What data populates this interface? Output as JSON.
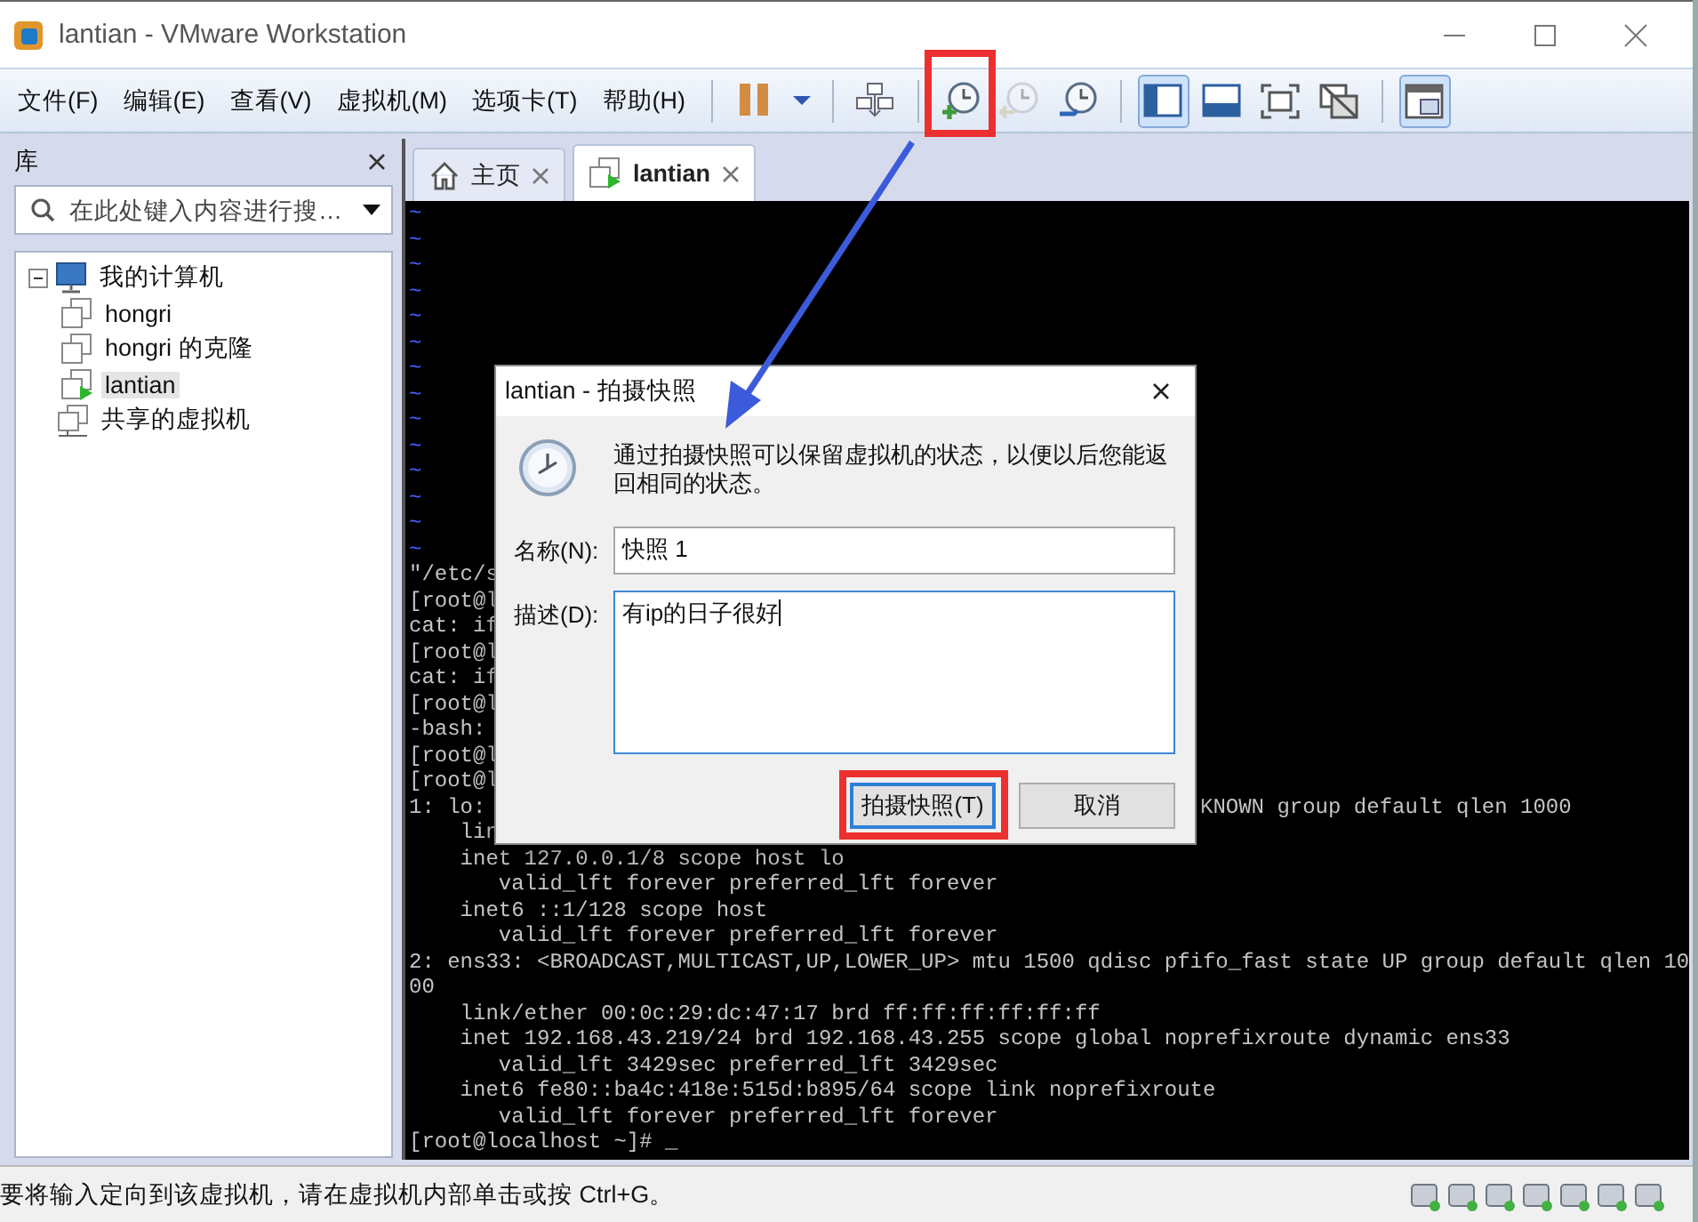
{
  "window": {
    "title": "lantian - VMware Workstation"
  },
  "menu": [
    "文件(F)",
    "编辑(E)",
    "查看(V)",
    "虚拟机(M)",
    "选项卡(T)",
    "帮助(H)"
  ],
  "toolbar": {
    "groups": [
      [
        {
          "kind": "pause",
          "selected": false,
          "disabled": false,
          "highlighted": false
        },
        {
          "kind": "caret",
          "selected": false,
          "disabled": false,
          "highlighted": false
        }
      ],
      [
        {
          "kind": "send-keys",
          "selected": false,
          "disabled": false,
          "highlighted": false
        }
      ],
      [
        {
          "kind": "snapshot-take",
          "selected": false,
          "disabled": false,
          "highlighted": true
        },
        {
          "kind": "snapshot-revert",
          "selected": false,
          "disabled": true,
          "highlighted": false
        },
        {
          "kind": "snapshot-manager",
          "selected": false,
          "disabled": false,
          "highlighted": false
        }
      ],
      [
        {
          "kind": "console-view",
          "selected": true,
          "disabled": false,
          "highlighted": false
        },
        {
          "kind": "thumbnail-bar",
          "selected": false,
          "disabled": false,
          "highlighted": false
        },
        {
          "kind": "full-screen",
          "selected": false,
          "disabled": false,
          "highlighted": false
        },
        {
          "kind": "unity",
          "selected": false,
          "disabled": false,
          "highlighted": false
        }
      ],
      [
        {
          "kind": "library-view",
          "selected": true,
          "disabled": false,
          "highlighted": false
        }
      ]
    ]
  },
  "library": {
    "title": "库",
    "search": {
      "placeholder": "在此处键入内容进行搜…"
    },
    "tree": [
      {
        "label": "我的计算机",
        "kind": "computer",
        "expanded": true,
        "selected": false,
        "children": [
          {
            "label": "hongri",
            "kind": "vm",
            "selected": false
          },
          {
            "label": "hongri 的克隆",
            "kind": "vm",
            "selected": false
          },
          {
            "label": "lantian",
            "kind": "vm-running",
            "selected": true
          }
        ]
      },
      {
        "label": "共享的虚拟机",
        "kind": "shared",
        "selected": false
      }
    ]
  },
  "tabs": [
    {
      "label": "主页",
      "kind": "home",
      "selected": false
    },
    {
      "label": "lantian",
      "kind": "vm",
      "selected": true
    }
  ],
  "terminal": {
    "lines": [
      {
        "text": "~",
        "kind": "tilde"
      },
      {
        "text": "~",
        "kind": "tilde"
      },
      {
        "text": "~",
        "kind": "tilde"
      },
      {
        "text": "~",
        "kind": "tilde"
      },
      {
        "text": "~",
        "kind": "tilde"
      },
      {
        "text": "~",
        "kind": "tilde"
      },
      {
        "text": "~",
        "kind": "tilde"
      },
      {
        "text": "~",
        "kind": "tilde"
      },
      {
        "text": "~",
        "kind": "tilde"
      },
      {
        "text": "~",
        "kind": "tilde"
      },
      {
        "text": "~",
        "kind": "tilde"
      },
      {
        "text": "~",
        "kind": "tilde"
      },
      {
        "text": "~",
        "kind": "tilde"
      },
      {
        "text": "~",
        "kind": "tilde"
      },
      {
        "text": "\"/etc/s",
        "kind": "output"
      },
      {
        "text": "[root@l",
        "kind": "output"
      },
      {
        "text": "cat: if",
        "kind": "output"
      },
      {
        "text": "[root@l",
        "kind": "output"
      },
      {
        "text": "cat: if",
        "kind": "output"
      },
      {
        "text": "[root@l",
        "kind": "output"
      },
      {
        "text": "-bash:",
        "kind": "output"
      },
      {
        "text": "[root@l",
        "kind": "output"
      },
      {
        "text": "[root@l",
        "kind": "output"
      },
      {
        "text": "1: lo:",
        "kind": "output",
        "tail": "KNOWN group default qlen 1000"
      },
      {
        "text": "    lin",
        "kind": "output"
      },
      {
        "text": "    inet 127.0.0.1/8 scope host lo",
        "kind": "output"
      },
      {
        "text": "       valid_lft forever preferred_lft forever",
        "kind": "output"
      },
      {
        "text": "    inet6 ::1/128 scope host",
        "kind": "output"
      },
      {
        "text": "       valid_lft forever preferred_lft forever",
        "kind": "output"
      },
      {
        "text": "2: ens33: <BROADCAST,MULTICAST,UP,LOWER_UP> mtu 1500 qdisc pfifo_fast state UP group default qlen 10",
        "kind": "output"
      },
      {
        "text": "00",
        "kind": "output"
      },
      {
        "text": "    link/ether 00:0c:29:dc:47:17 brd ff:ff:ff:ff:ff:ff",
        "kind": "output"
      },
      {
        "text": "    inet 192.168.43.219/24 brd 192.168.43.255 scope global noprefixroute dynamic ens33",
        "kind": "output"
      },
      {
        "text": "       valid_lft 3429sec preferred_lft 3429sec",
        "kind": "output"
      },
      {
        "text": "    inet6 fe80::ba4c:418e:515d:b895/64 scope link noprefixroute",
        "kind": "output"
      },
      {
        "text": "       valid_lft forever preferred_lft forever",
        "kind": "output"
      },
      {
        "text": "[root@localhost ~]# _",
        "kind": "output"
      }
    ]
  },
  "dialog": {
    "title": "lantian - 拍摄快照",
    "message": "通过拍摄快照可以保留虚拟机的状态，以便以后您能返回相同的状态。",
    "fields": [
      {
        "label": "名称(N):",
        "value": "快照 1",
        "kind": "input",
        "focused": false
      },
      {
        "label": "描述(D):",
        "value": "有ip的日子很好",
        "kind": "textarea",
        "focused": true
      }
    ],
    "buttons": [
      {
        "label": "拍摄快照(T)",
        "default": true,
        "highlighted": true
      },
      {
        "label": "取消",
        "default": false,
        "highlighted": false
      }
    ]
  },
  "status_bar": {
    "text": "要将输入定向到该虚拟机，请在虚拟机内部单击或按 Ctrl+G。"
  }
}
